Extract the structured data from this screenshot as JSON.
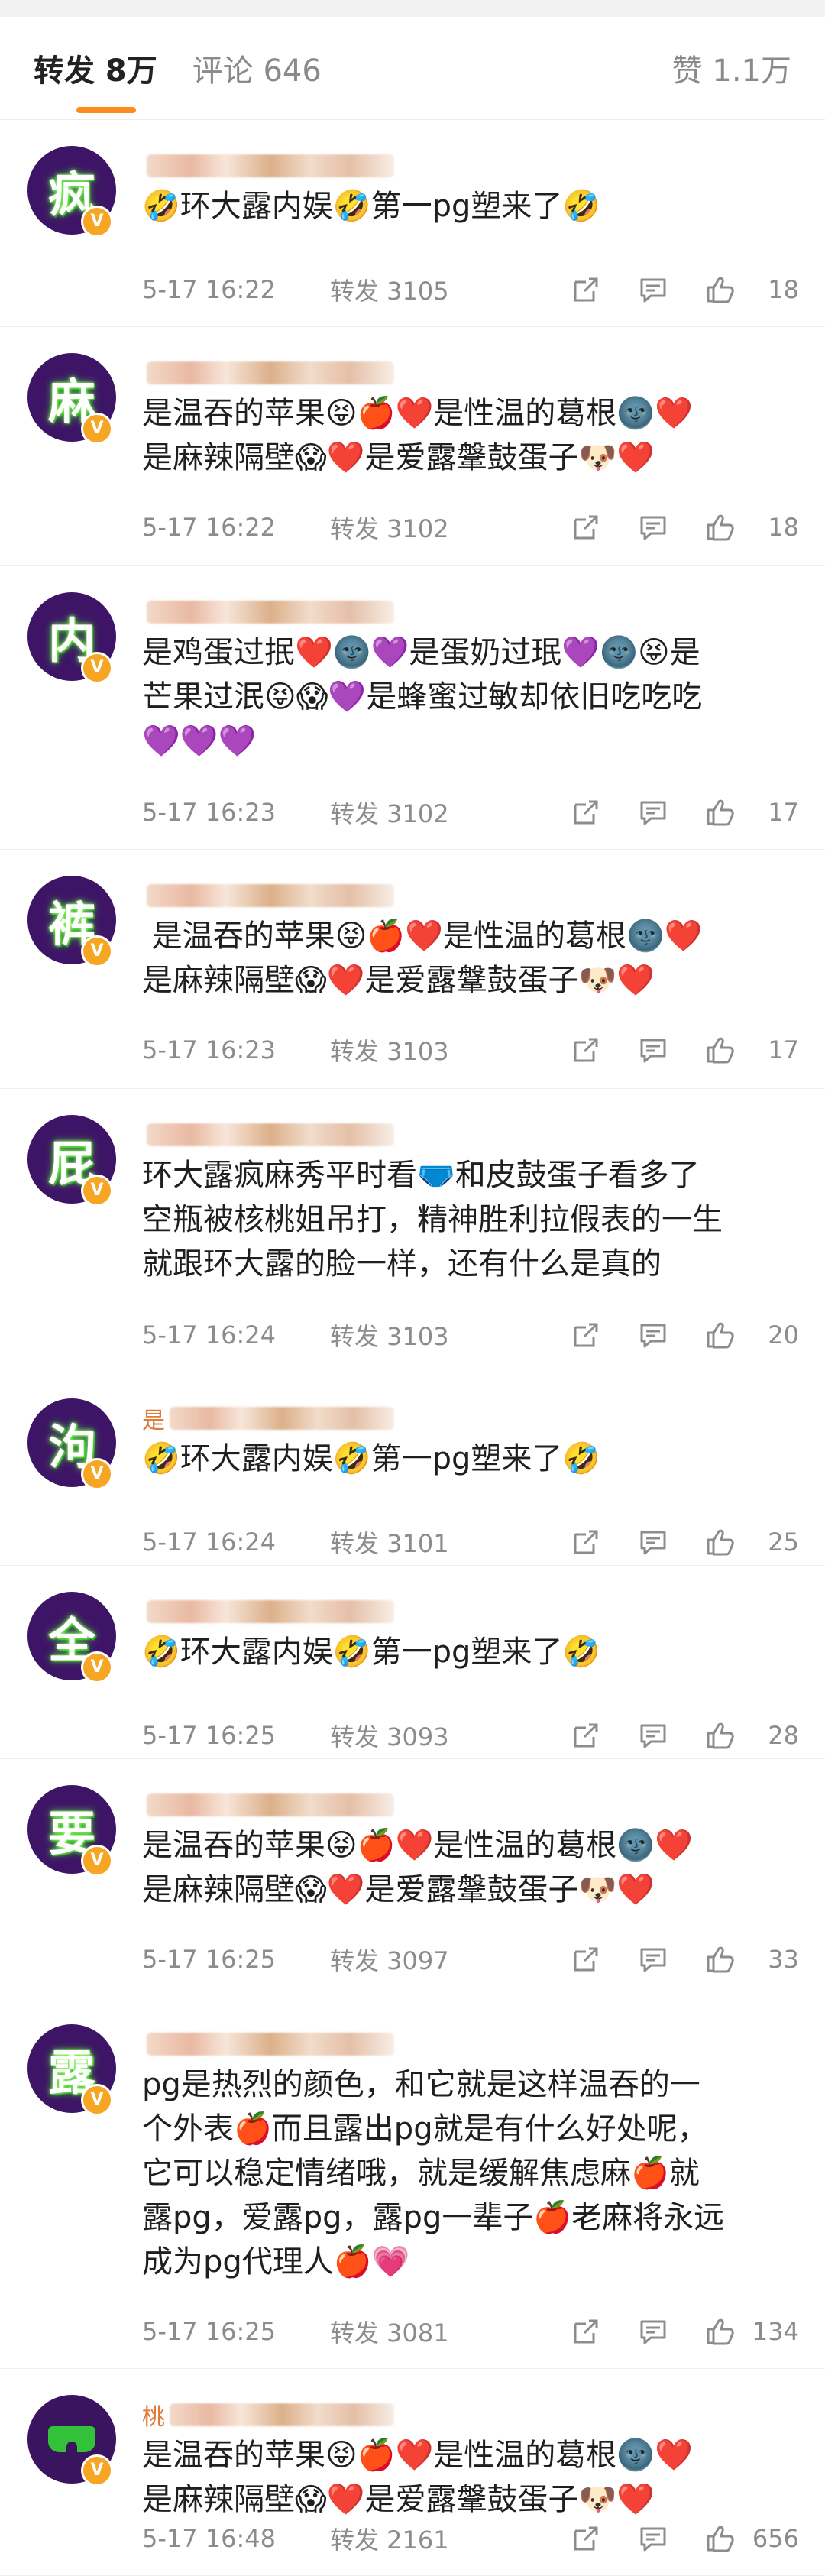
{
  "tabs": {
    "reposts": "转发 8万",
    "comments": "评论 646",
    "likes": "赞 1.1万"
  },
  "colors": {
    "accent": "#ff8a1d",
    "avatar_bg": "#3e1566",
    "glow": "#3fe02c",
    "verified": "#f6a623"
  },
  "comments": [
    {
      "avatar_char": "疯",
      "username_prefix": "",
      "text": "🤣环大露内娱🤣第一pg塑来了🤣",
      "time": "5-17 16:22",
      "repost": "转发 3105",
      "likes": "18"
    },
    {
      "avatar_char": "麻",
      "username_prefix": "",
      "text": "是温吞的苹果😝🍎❤️是性温的葛根🌚❤️\n是麻辣隔壁😱❤️是爱露鞶鼓蛋子🐶❤️",
      "time": "5-17 16:22",
      "repost": "转发 3102",
      "likes": "18"
    },
    {
      "avatar_char": "内",
      "username_prefix": "",
      "text": "是鸡蛋过抿❤️🌚💜是蛋奶过珉💜🌚😝是\n芒果过泯😝😱💜是蜂蜜过敏却依旧吃吃吃\n💜💜💜",
      "time": "5-17 16:23",
      "repost": "转发 3102",
      "likes": "17"
    },
    {
      "avatar_char": "裤",
      "username_prefix": "",
      "text": " 是温吞的苹果😝🍎❤️是性温的葛根🌚❤️\n是麻辣隔壁😱❤️是爱露鞶鼓蛋子🐶❤️",
      "time": "5-17 16:23",
      "repost": "转发 3103",
      "likes": "17"
    },
    {
      "avatar_char": "屁",
      "username_prefix": "",
      "text": "环大露疯麻秀平时看🩲和皮鼓蛋子看多了\n空瓶被核桃姐吊打，精神胜利拉假表的一生\n就跟环大露的脸一样，还有什么是真的",
      "time": "5-17 16:24",
      "repost": "转发 3103",
      "likes": "20"
    },
    {
      "avatar_char": "泃",
      "username_prefix": "是",
      "text": "🤣环大露内娱🤣第一pg塑来了🤣",
      "time": "5-17 16:24",
      "repost": "转发 3101",
      "likes": "25"
    },
    {
      "avatar_char": "全",
      "username_prefix": "",
      "text": "🤣环大露内娱🤣第一pg塑来了🤣",
      "time": "5-17 16:25",
      "repost": "转发 3093",
      "likes": "28"
    },
    {
      "avatar_char": "要",
      "username_prefix": "",
      "text": "是温吞的苹果😝🍎❤️是性温的葛根🌚❤️\n是麻辣隔壁😱❤️是爱露鞶鼓蛋子🐶❤️",
      "time": "5-17 16:25",
      "repost": "转发 3097",
      "likes": "33"
    },
    {
      "avatar_char": "露",
      "username_prefix": "",
      "text": "pg是热烈的颜色，和它就是这样温吞的一\n个外表🍎而且露出pg就是有什么好处呢，\n它可以稳定情绪哦，就是缓解焦虑麻🍎就\n露pg，爱露pg，露pg一辈子🍎老麻将永远\n成为pg代理人🍎💗",
      "time": "5-17 16:25",
      "repost": "转发 3081",
      "likes": "134"
    },
    {
      "avatar_char": "",
      "username_prefix": "桃",
      "text": "是温吞的苹果😝🍎❤️是性温的葛根🌚❤️\n是麻辣隔壁😱❤️是爱露鞶鼓蛋子🐶❤️",
      "time": "5-17 16:48",
      "repost": "转发 2161",
      "likes": "656"
    }
  ]
}
